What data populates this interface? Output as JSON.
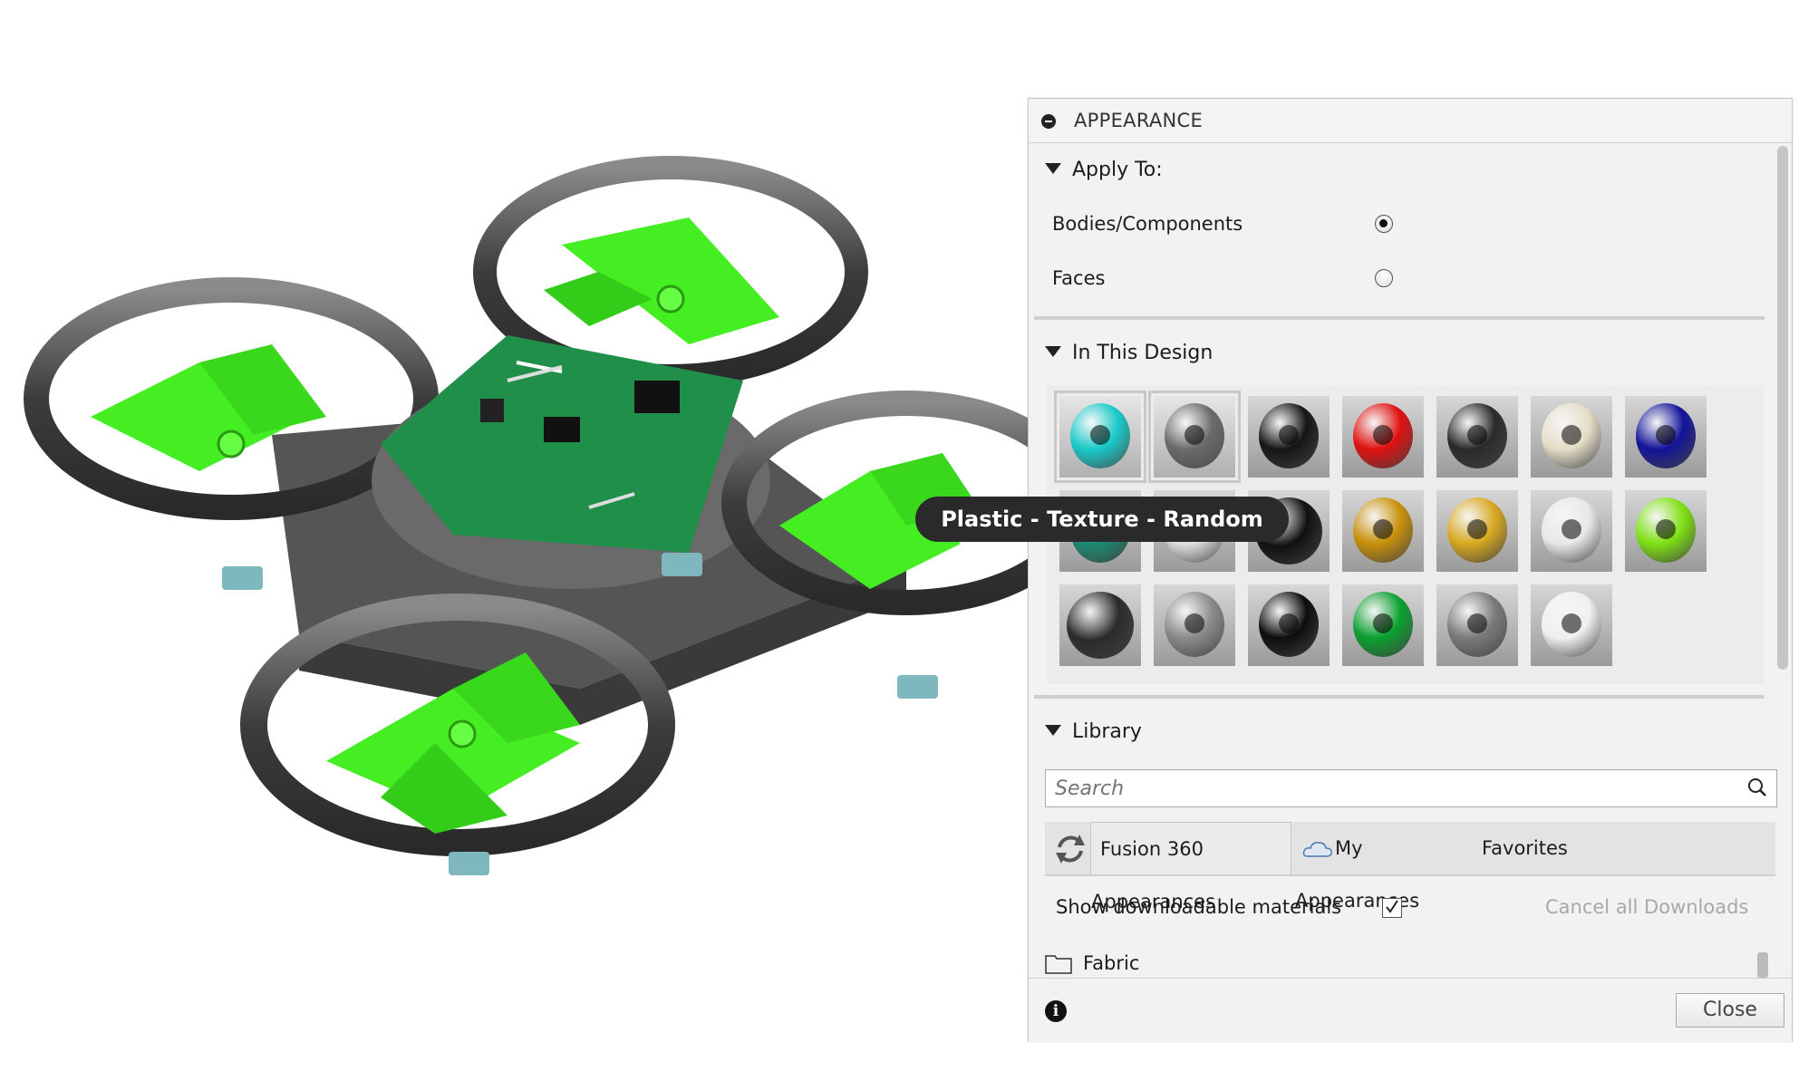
{
  "panel": {
    "title": "APPEARANCE",
    "apply_to": {
      "heading": "Apply To:",
      "options": [
        {
          "label": "Bodies/Components",
          "selected": true
        },
        {
          "label": "Faces",
          "selected": false
        }
      ]
    },
    "in_this_design": {
      "heading": "In This Design",
      "swatches": [
        {
          "icon": "torus",
          "color": "#19c9c9"
        },
        {
          "icon": "torus",
          "color": "#6a6a6a"
        },
        {
          "icon": "torus",
          "color": "#151515"
        },
        {
          "icon": "torus",
          "color": "#e01010"
        },
        {
          "icon": "torus",
          "color": "#2a2a2a"
        },
        {
          "icon": "torus",
          "color": "#e4ddc8"
        },
        {
          "icon": "torus",
          "color": "#13139a"
        },
        {
          "icon": "torus",
          "color": "#1a8a70"
        },
        {
          "icon": "torus",
          "color": "#e0e0e0"
        },
        {
          "icon": "sphere",
          "color": "#101010"
        },
        {
          "icon": "torus",
          "color": "#c8900a"
        },
        {
          "icon": "torus",
          "color": "#d8a820"
        },
        {
          "icon": "torus",
          "color": "#e8e8e8"
        },
        {
          "icon": "torus",
          "color": "#7fe014"
        },
        {
          "icon": "sphere",
          "color": "#2b2b2b"
        },
        {
          "icon": "torus",
          "color": "#8a8a8a"
        },
        {
          "icon": "torus",
          "color": "#0d0d0d"
        },
        {
          "icon": "torus",
          "color": "#0aa030"
        },
        {
          "icon": "torus",
          "color": "#7a7a7a"
        },
        {
          "icon": "torus",
          "color": "#f0f0f0"
        }
      ]
    },
    "library": {
      "heading": "Library",
      "search_placeholder": "Search",
      "tabs": [
        {
          "label": "Fusion 360 Appearances",
          "active": true
        },
        {
          "label": "My Appearances",
          "active": false
        },
        {
          "label": "Favorites",
          "active": false
        }
      ],
      "show_downloadable": {
        "label": "Show downloadable materials",
        "checked": true
      },
      "cancel_downloads": "Cancel all Downloads",
      "folders": [
        "Fabric"
      ]
    },
    "close_label": "Close"
  },
  "tooltip": "Plastic - Texture - Random",
  "colors": {
    "rotor_green": "#44ee22",
    "pcb_green": "#1f8f4a",
    "frame_gray": "#4a4a4a"
  }
}
